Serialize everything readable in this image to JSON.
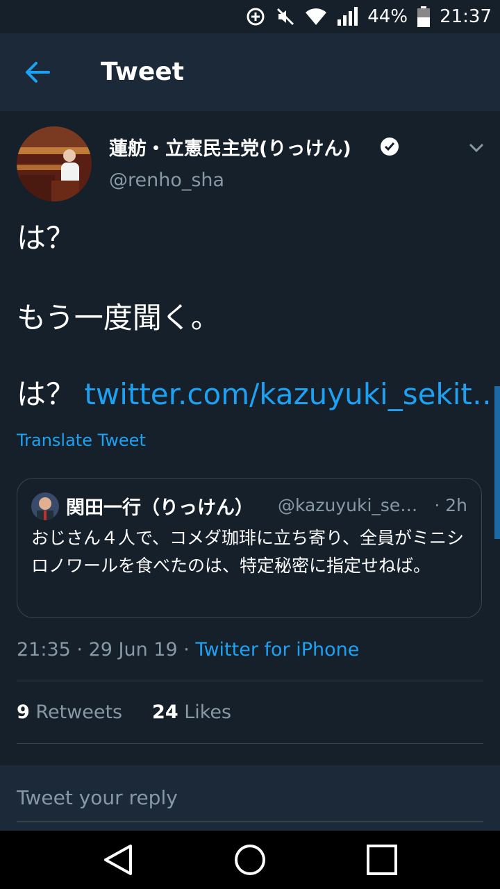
{
  "status_bar": {
    "battery": "44%",
    "time": "21:37"
  },
  "header": {
    "title": "Tweet"
  },
  "tweet": {
    "author_name": "蓮舫・立憲民主党(りっけん)",
    "handle": "@renho_sha",
    "lines": [
      "は？",
      "もう一度聞く。",
      "は？"
    ],
    "link": "twitter.com/kazuyuki_sekit…",
    "translate_label": "Translate Tweet",
    "quote": {
      "author_name": "関田一行（りっけん）",
      "handle": "@kazuyuki_se…",
      "time": "· 2h",
      "text": "おじさん４人で、コメダ珈琲に立ち寄り、全員がミニシロノワールを食べたのは、特定秘密に指定せねば。"
    },
    "time": "21:35",
    "date": "29 Jun 19",
    "source": "Twitter for iPhone",
    "retweets_count": "9",
    "retweets_label": "Retweets",
    "likes_count": "24",
    "likes_label": "Likes"
  },
  "reply": {
    "placeholder": "Tweet your reply"
  },
  "colors": {
    "background": "#15202b",
    "header": "#1c2938",
    "accent": "#1da1f2",
    "muted": "#8899a6",
    "border": "#38444d"
  }
}
